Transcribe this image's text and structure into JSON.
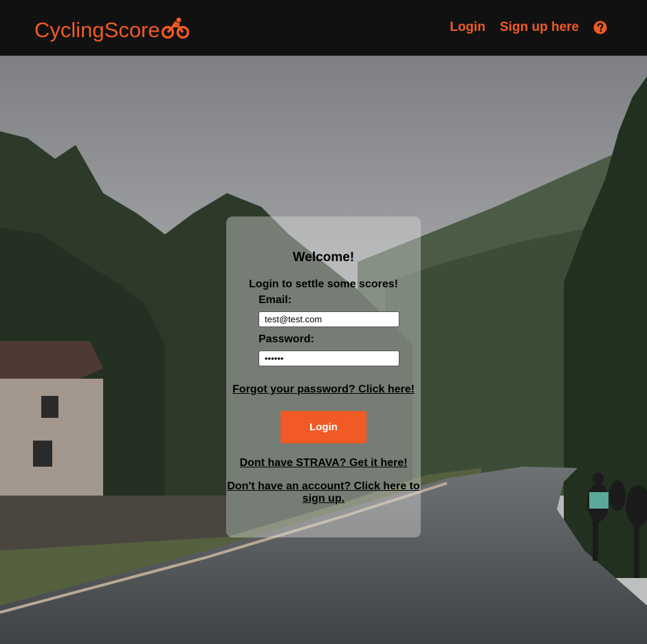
{
  "header": {
    "brand": "CyclingScore",
    "brand_icon": "bicycle-icon",
    "nav_login": "Login",
    "nav_signup": "Sign up here",
    "help_icon": "question-circle-icon"
  },
  "colors": {
    "accent": "#f15a24",
    "navbar_bg": "#111111"
  },
  "card": {
    "title": "Welcome!",
    "subtitle": "Login to settle some scores!",
    "email_label": "Email:",
    "email_value": "test@test.com",
    "password_label": "Password:",
    "password_value": "••••••",
    "forgot_link": "Forgot your password? Click here!",
    "login_button": "Login",
    "strava_link": "Dont have STRAVA? Get it here!",
    "signup_link": "Don't have an account? Click here to sign up."
  }
}
